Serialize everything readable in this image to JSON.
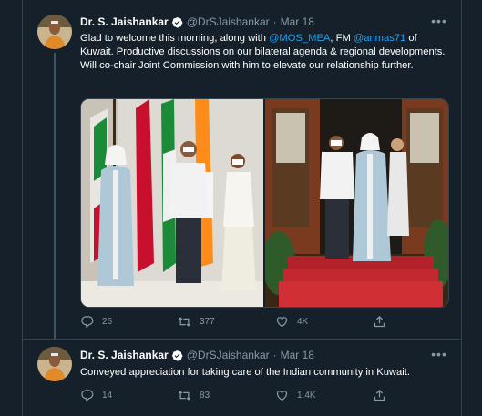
{
  "tweets": [
    {
      "author": "Dr. S. Jaishankar",
      "handle": "@DrSJaishankar",
      "separator": "·",
      "date": "Mar 18",
      "text_parts": {
        "a": "Glad to welcome this morning, along with ",
        "m1": "@MOS_MEA",
        "b": ", FM ",
        "m2": "@anmas71",
        "c": " of Kuwait. Productive discussions on our bilateral agenda & regional developments. Will co-chair Joint Commission with him to elevate our relationship further."
      },
      "replies": "26",
      "retweets": "377",
      "likes": "4K",
      "more_label": "•••"
    },
    {
      "author": "Dr. S. Jaishankar",
      "handle": "@DrSJaishankar",
      "separator": "·",
      "date": "Mar 18",
      "text": "Conveyed appreciation for taking care of the Indian community in Kuwait.",
      "replies": "14",
      "retweets": "83",
      "likes": "1.4K",
      "more_label": "•••"
    }
  ],
  "icons": [
    "verified-badge-icon",
    "more-icon",
    "reply-icon",
    "retweet-icon",
    "like-icon",
    "share-icon"
  ],
  "colors": {
    "background": "#15202b",
    "border": "#38444d",
    "secondary_text": "#8899a6",
    "accent": "#1da1f2"
  }
}
